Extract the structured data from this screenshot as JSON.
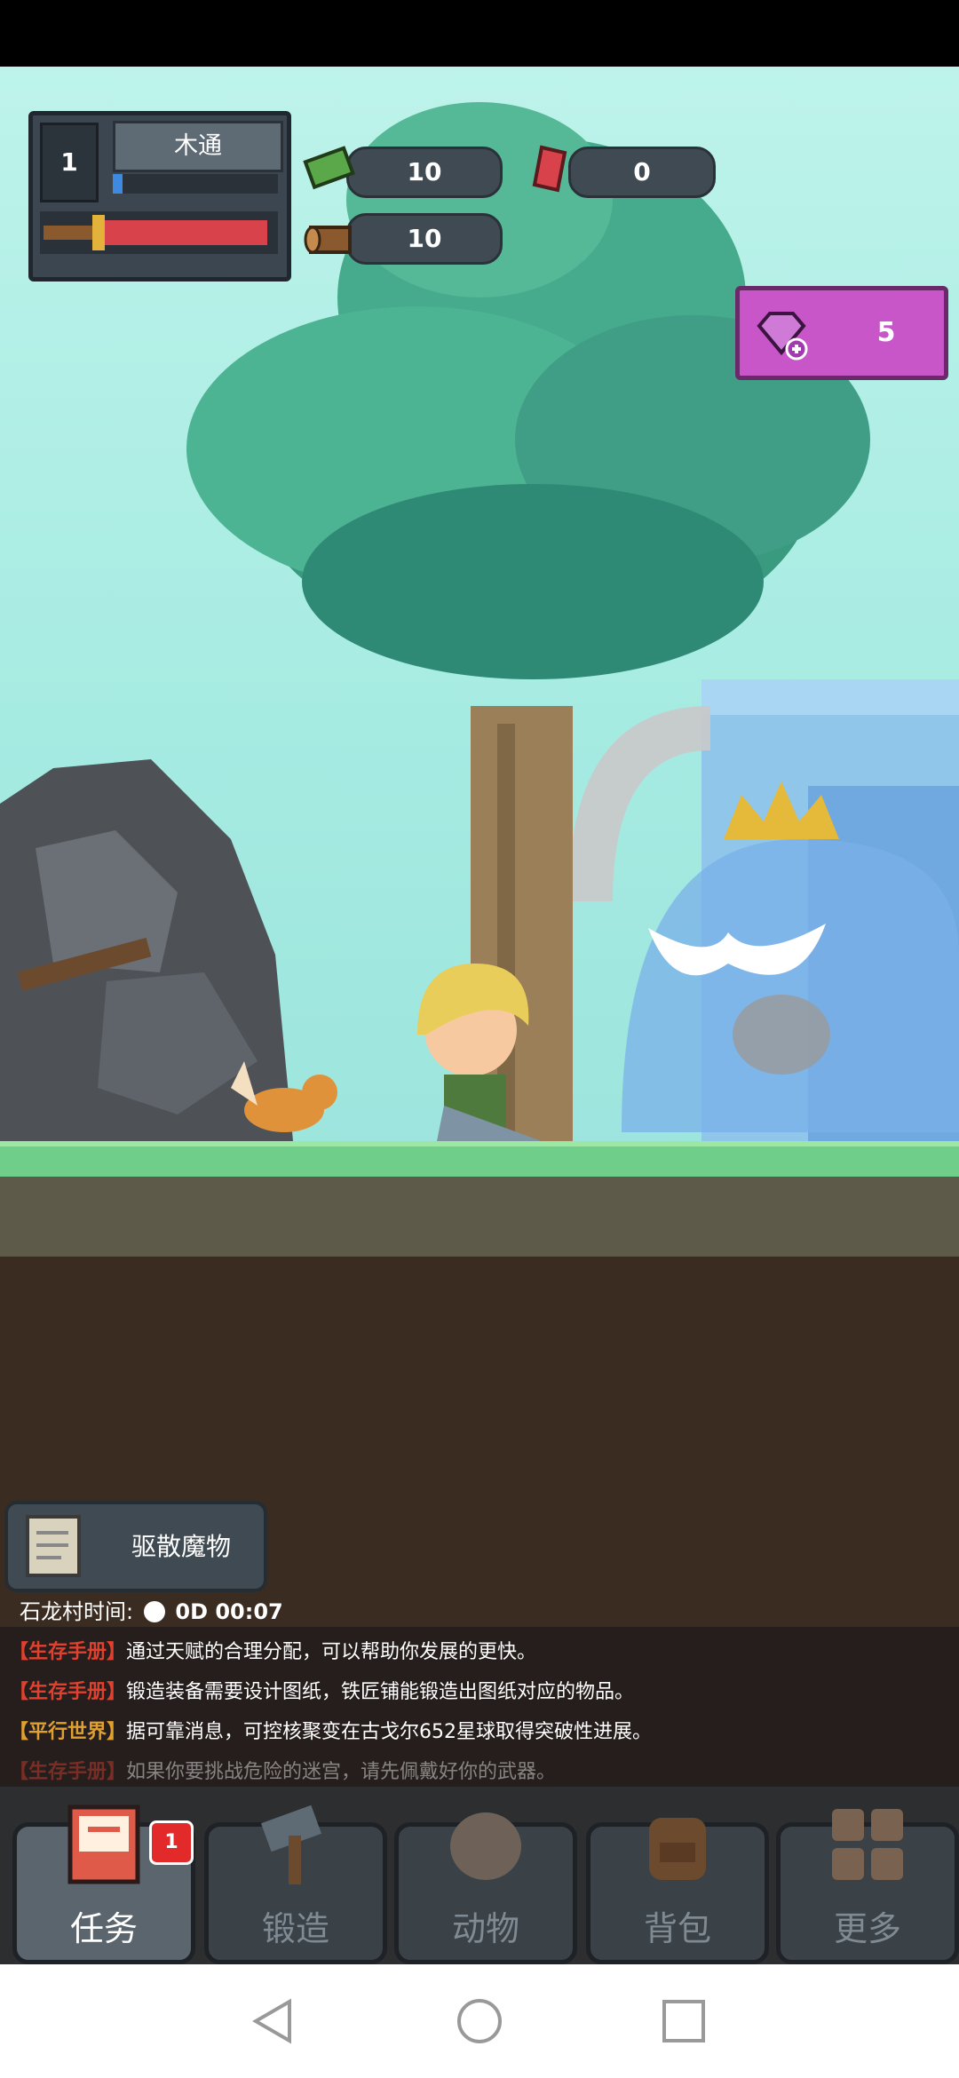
{
  "hud": {
    "level": "1",
    "player_name": "木通",
    "xp_fraction": 0.06,
    "hp_fraction": 0.95,
    "cash": "10",
    "ruby": "0",
    "wood": "10",
    "gems": "5"
  },
  "quest": {
    "label": "驱散魔物"
  },
  "timer": {
    "label": "石龙村时间:",
    "value": "0D 00:07"
  },
  "log": [
    {
      "tag": "【生存手册】",
      "tag_color": "#e0402e",
      "text": "通过天赋的合理分配，可以帮助你发展的更快。"
    },
    {
      "tag": "【生存手册】",
      "tag_color": "#e0402e",
      "text": "锻造装备需要设计图纸，铁匠铺能锻造出图纸对应的物品。"
    },
    {
      "tag": "【平行世界】",
      "tag_color": "#e0a030",
      "text": "据可靠消息，可控核聚变在古戈尔652星球取得突破性进展。"
    },
    {
      "tag": "【生存手册】",
      "tag_color": "#e0402e",
      "text": "如果你要挑战危险的迷宫，请先佩戴好你的武器。"
    }
  ],
  "nav": [
    {
      "label": "任务",
      "icon": "task-book-icon",
      "active": true
    },
    {
      "label": "锻造",
      "icon": "hammer-icon",
      "active": false
    },
    {
      "label": "动物",
      "icon": "egg-icon",
      "active": false
    },
    {
      "label": "背包",
      "icon": "backpack-icon",
      "active": false
    },
    {
      "label": "更多",
      "icon": "grid-more-icon",
      "active": false
    }
  ],
  "badge": "1",
  "colors": {
    "accent_gem": "#c856c8",
    "hp": "#d8434b",
    "xp": "#3d8ae0"
  }
}
